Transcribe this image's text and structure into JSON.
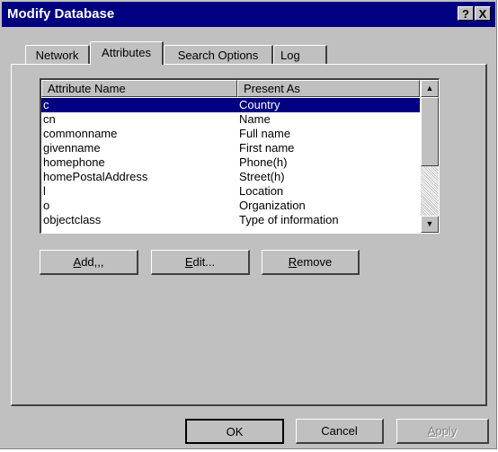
{
  "window": {
    "title": "Modify Database",
    "help_label": "?",
    "close_label": "X"
  },
  "tabs": [
    {
      "label": "Network"
    },
    {
      "label": "Attributes"
    },
    {
      "label": "Search Options"
    },
    {
      "label": "Log"
    }
  ],
  "active_tab": "Attributes",
  "attributes_list": {
    "columns": [
      "Attribute Name",
      "Present As"
    ],
    "rows": [
      {
        "name": "c",
        "present_as": "Country",
        "selected": true
      },
      {
        "name": "cn",
        "present_as": "Name"
      },
      {
        "name": "commonname",
        "present_as": "Full name"
      },
      {
        "name": "givenname",
        "present_as": "First name"
      },
      {
        "name": "homephone",
        "present_as": "Phone(h)"
      },
      {
        "name": "homePostalAddress",
        "present_as": "Street(h)"
      },
      {
        "name": "l",
        "present_as": "Location"
      },
      {
        "name": "o",
        "present_as": "Organization"
      },
      {
        "name": "objectclass",
        "present_as": "Type of information"
      }
    ]
  },
  "list_buttons": {
    "add": {
      "mnemonic": "A",
      "rest": "dd,,,"
    },
    "edit": {
      "mnemonic": "E",
      "rest": "dit..."
    },
    "remove": {
      "mnemonic": "R",
      "rest": "emove"
    }
  },
  "footer_buttons": {
    "ok": "OK",
    "cancel": "Cancel",
    "apply": {
      "mnemonic": "A",
      "rest": "pply",
      "enabled": false
    }
  },
  "scrollbar": {
    "up_icon": "▲",
    "down_icon": "▼"
  }
}
